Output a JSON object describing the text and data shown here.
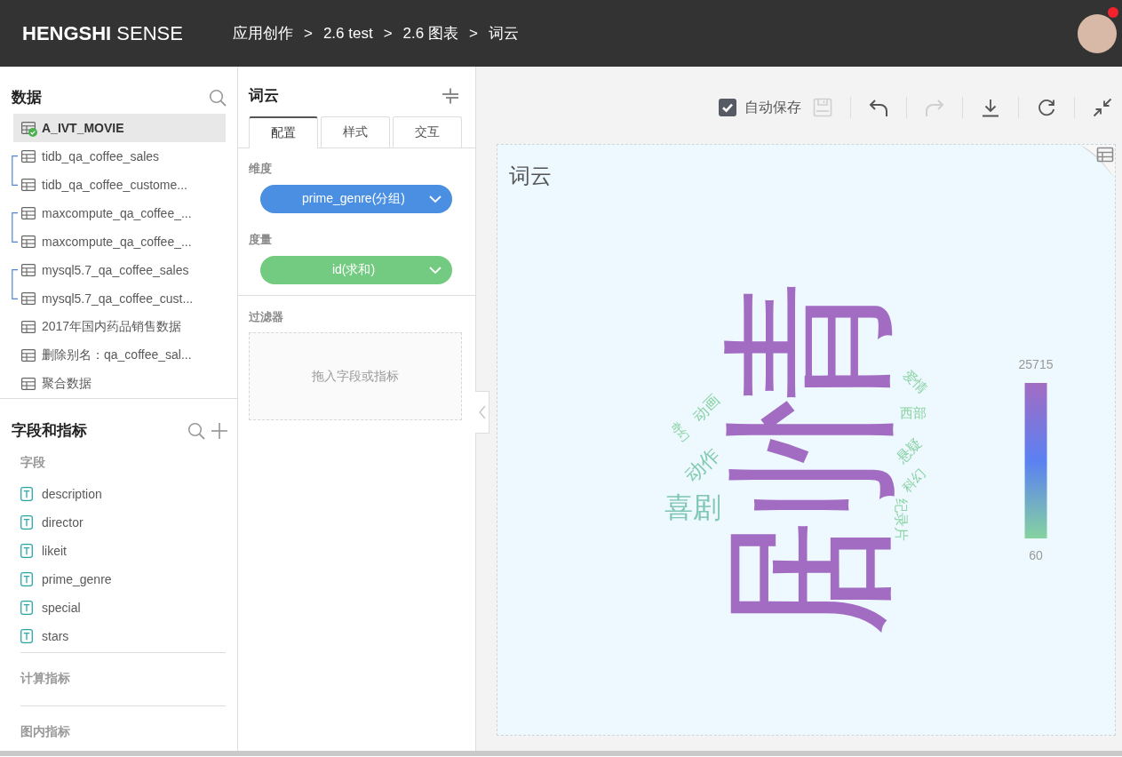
{
  "header": {
    "logo": "**HENGSHI** SENSE",
    "breadcrumb": [
      {
        "label": "应用创作"
      },
      {
        "separator": ">",
        "label": "2.6 test"
      },
      {
        "separator": ">",
        "label": "2.6 图表"
      },
      {
        "separator": ">",
        "label": "词云"
      }
    ],
    "notification": true
  },
  "data_panel": {
    "title": "数据",
    "items": [
      {
        "kind": "table",
        "name": "A_IVT_MOVIE",
        "selected": true,
        "checkmark": true
      },
      {
        "kind": "joined",
        "tables": [
          {
            "name": "tidb_qa_coffee_sales",
            "selected": false,
            "checkmark": false
          },
          {
            "name": "tidb_qa_coffee_custome...",
            "selected": false,
            "checkmark": false
          }
        ]
      },
      {
        "kind": "joined",
        "tables": [
          {
            "name": "maxcompute_qa_coffee_...",
            "selected": false,
            "checkmark": false
          },
          {
            "name": "maxcompute_qa_coffee_...",
            "selected": false,
            "checkmark": false
          }
        ]
      },
      {
        "kind": "joined",
        "tables": [
          {
            "name": "mysql5.7_qa_coffee_sales",
            "selected": false,
            "checkmark": false
          },
          {
            "name": "mysql5.7_qa_coffee_cust...",
            "selected": false,
            "checkmark": false
          }
        ]
      },
      {
        "kind": "table",
        "name": "2017年国内药品销售数据",
        "selected": false,
        "checkmark": false
      },
      {
        "kind": "table",
        "name": "删除别名：qa_coffee_sal...",
        "selected": false,
        "checkmark": false
      },
      {
        "kind": "table",
        "name": "聚合数据",
        "selected": false,
        "checkmark": false
      }
    ]
  },
  "fields_panel": {
    "title": "字段和指标",
    "groups": [
      {
        "label": "字段",
        "fields": [
          "description",
          "director",
          "likeit",
          "prime_genre",
          "special",
          "stars"
        ]
      },
      {
        "label": "计算指标"
      },
      {
        "label": "图内指标"
      }
    ]
  },
  "editor": {
    "title": "词云",
    "tabs": [
      {
        "label": "配置",
        "selected": true
      },
      {
        "label": "样式",
        "selected": false
      },
      {
        "label": "交互",
        "selected": false
      }
    ],
    "shelves": [
      {
        "kind": "dimension",
        "label": "维度",
        "fields": [
          "prime_genre(分组)"
        ]
      },
      {
        "kind": "measure",
        "label": "度量",
        "fields": [
          "id(求和)"
        ]
      }
    ],
    "filter": {
      "label": "过滤器",
      "hint": "拖入字段或指标"
    }
  },
  "toolbar": {
    "autosave": {
      "label": "自动保存",
      "checked": true
    },
    "buttons": [
      {
        "kind": "save",
        "disabled": true
      },
      {
        "kind": "undo",
        "disabled": false
      },
      {
        "kind": "redo",
        "disabled": true
      },
      {
        "kind": "download",
        "disabled": false
      },
      {
        "kind": "refresh",
        "disabled": false
      },
      {
        "kind": "shrink",
        "disabled": false
      }
    ]
  },
  "chart": {
    "title": "词云",
    "words": [
      {
        "text": "剧情",
        "color": "#a36cc3"
      },
      {
        "text": "喜剧",
        "color": "#7fc6b3"
      },
      {
        "text": "动作",
        "color": "#83c9ae"
      },
      {
        "text": "动画",
        "color": "#88d1a4"
      },
      {
        "text": "奇幻",
        "color": "#8ad3a2"
      },
      {
        "text": "爱情",
        "color": "#89d2a3"
      },
      {
        "text": "西部",
        "color": "#8ad3a2"
      },
      {
        "text": "悬疑",
        "color": "#88d0a4"
      },
      {
        "text": "科幻",
        "color": "#89d2a3"
      },
      {
        "text": "纪录片",
        "color": "#8ad3a2"
      }
    ],
    "legend": {
      "max": "25715",
      "min": "60"
    }
  }
}
